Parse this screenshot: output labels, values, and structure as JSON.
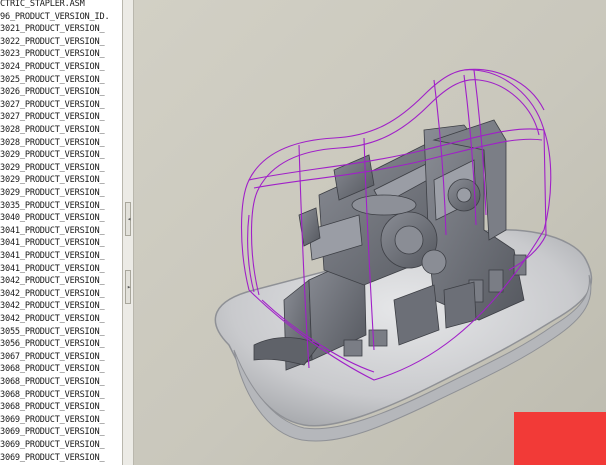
{
  "model_tree": {
    "items": [
      "CTRIC_STAPLER.ASM",
      "96_PRODUCT_VERSION_ID.",
      "3021_PRODUCT_VERSION_",
      "3022_PRODUCT_VERSION_",
      "3023_PRODUCT_VERSION_",
      "3024_PRODUCT_VERSION_",
      "3025_PRODUCT_VERSION_",
      "3026_PRODUCT_VERSION_",
      "3027_PRODUCT_VERSION_",
      "3027_PRODUCT_VERSION_",
      "3028_PRODUCT_VERSION_",
      "3028_PRODUCT_VERSION_",
      "3029_PRODUCT_VERSION_",
      "3029_PRODUCT_VERSION_",
      "3029_PRODUCT_VERSION_",
      "3029_PRODUCT_VERSION_",
      "3035_PRODUCT_VERSION_",
      "3040_PRODUCT_VERSION_",
      "3041_PRODUCT_VERSION_",
      "3041_PRODUCT_VERSION_",
      "3041_PRODUCT_VERSION_",
      "3041_PRODUCT_VERSION_",
      "3042_PRODUCT_VERSION_",
      "3042_PRODUCT_VERSION_",
      "3042_PRODUCT_VERSION_",
      "3042_PRODUCT_VERSION_",
      "3055_PRODUCT_VERSION_",
      "3056_PRODUCT_VERSION_",
      "3067_PRODUCT_VERSION_",
      "3068_PRODUCT_VERSION_",
      "3068_PRODUCT_VERSION_",
      "3068_PRODUCT_VERSION_",
      "3068_PRODUCT_VERSION_",
      "3069_PRODUCT_VERSION_",
      "3069_PRODUCT_VERSION_",
      "3069_PRODUCT_VERSION_",
      "3069_PRODUCT_VERSION_"
    ]
  },
  "splitter": {
    "collapse_left_glyph": "◂",
    "collapse_right_glyph": "▸"
  },
  "viewport": {
    "background": "#c9c7bb",
    "shell_color": "#a020c8",
    "part_color": "#6e717a",
    "base_color": "#d2d3d5"
  },
  "overlay": {
    "color": "#f23a37"
  }
}
